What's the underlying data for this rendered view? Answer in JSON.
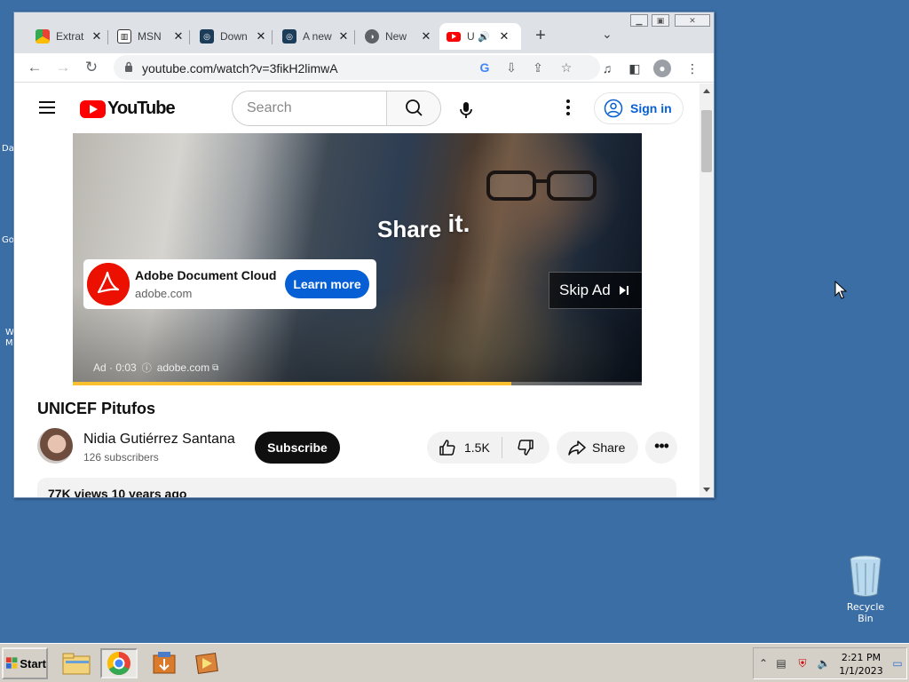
{
  "desktop": {
    "edge_labels": [
      "Da",
      "Go",
      "W",
      "M"
    ],
    "recycle_bin_label": "Recycle Bin"
  },
  "browser": {
    "tabs": [
      {
        "title": "Extrat",
        "icon": "chrome-extension-icon",
        "active": false
      },
      {
        "title": "MSN",
        "icon": "msn-icon",
        "active": false
      },
      {
        "title": "Down",
        "icon": "download-site-icon",
        "active": false
      },
      {
        "title": "A new",
        "icon": "site-icon",
        "active": false
      },
      {
        "title": "New",
        "icon": "globe-icon",
        "active": false
      },
      {
        "title": "U",
        "icon": "youtube-icon",
        "active": true,
        "audio": true
      }
    ],
    "url": "youtube.com/watch?v=3fikH2limwA",
    "window_controls": [
      "minimize",
      "restore",
      "close"
    ]
  },
  "youtube": {
    "logo_text": "YouTube",
    "search_placeholder": "Search",
    "signin_label": "Sign in",
    "ad": {
      "overlay_text": "Share it.",
      "overlay_text_part1": "Share",
      "overlay_text_part2": "it.",
      "advertiser": "Adobe Document Cloud",
      "domain": "adobe.com",
      "cta": "Learn more",
      "skip_label": "Skip Ad",
      "meta_time": "Ad · 0:03",
      "meta_domain": "adobe.com",
      "progress_fraction": 0.77
    },
    "video_title": "UNICEF Pitufos",
    "channel_name": "Nidia Gutiérrez Santana",
    "subscribers": "126 subscribers",
    "subscribe_label": "Subscribe",
    "likes": "1.5K",
    "share_label": "Share",
    "description_meta": "77K views  10 years ago"
  },
  "taskbar": {
    "start_label": "Start",
    "clock_time": "2:21 PM",
    "clock_date": "1/1/2023"
  }
}
